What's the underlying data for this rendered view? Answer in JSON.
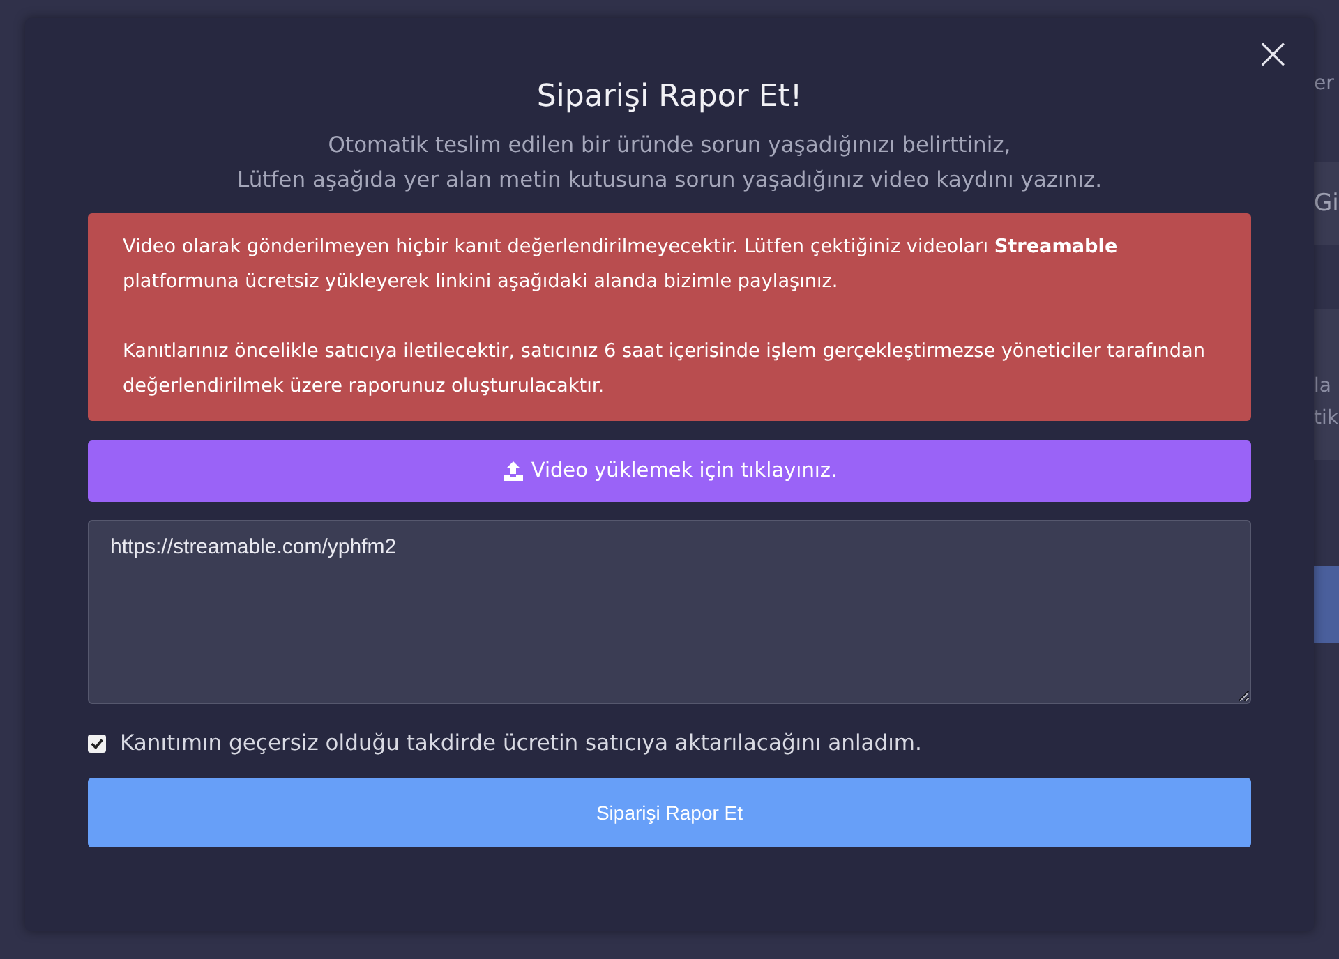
{
  "background": {
    "fragments": [
      "er",
      "Gi",
      "la",
      "tik"
    ]
  },
  "modal": {
    "close": "×",
    "title": "Siparişi Rapor Et!",
    "subtitle": [
      "Otomatik teslim edilen bir üründe sorun yaşadığınızı belirttiniz,",
      "Lütfen aşağıda yer alan metin kutusuna sorun yaşadığınız video kaydını yazınız."
    ],
    "alert": [
      "Video olarak gönderilmeyen hiçbir kanıt değerlendirilmeyecektir. Lütfen çektiğiniz videoları **Streamable** platformuna ücretsiz yükleyerek linkini aşağıdaki alanda bizimle paylaşınız.",
      "Kanıtlarınız öncelikle satıcıya iletilecektir, satıcınız 6 saat içerisinde işlem gerçekleştirmezse yöneticiler tarafından değerlendirilmek üzere raporunuz oluşturulacaktır."
    ],
    "upload_button": "Video yüklemek için tıklayınız.",
    "link_field": {
      "value": "https://streamable.com/yphfm2"
    },
    "agreement": {
      "label": "Kanıtımın geçersiz olduğu takdirde ücretin satıcıya aktarılacağını anladım.",
      "checked": true
    },
    "submit_button": "Siparişi Rapor Et"
  }
}
